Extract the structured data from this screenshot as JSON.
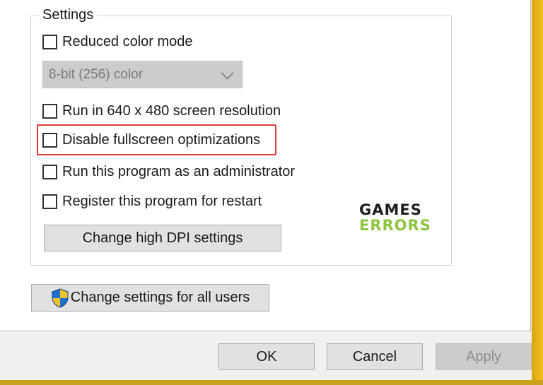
{
  "settings_group": {
    "legend": "Settings",
    "checkboxes": [
      {
        "label": "Reduced color mode",
        "checked": false
      },
      {
        "label": "Run in 640 x 480 screen resolution",
        "checked": false
      },
      {
        "label": "Disable fullscreen optimizations",
        "checked": false,
        "highlighted": true
      },
      {
        "label": "Run this program as an administrator",
        "checked": false
      },
      {
        "label": "Register this program for restart",
        "checked": false
      }
    ],
    "color_select": {
      "value": "8-bit (256) color",
      "disabled": true
    },
    "dpi_button": "Change high DPI settings"
  },
  "all_users_button": {
    "label": "Change settings for all users",
    "icon": "uac-shield-icon"
  },
  "dialog_buttons": {
    "ok": "OK",
    "cancel": "Cancel",
    "apply": "Apply"
  },
  "watermark": {
    "line1": "GAMES",
    "line2": "ERRORS"
  },
  "colors": {
    "highlight": "#e03a3a",
    "watermark_green": "#8cc63f",
    "shield_blue": "#1f6fd1",
    "shield_yellow": "#f2c12e"
  }
}
